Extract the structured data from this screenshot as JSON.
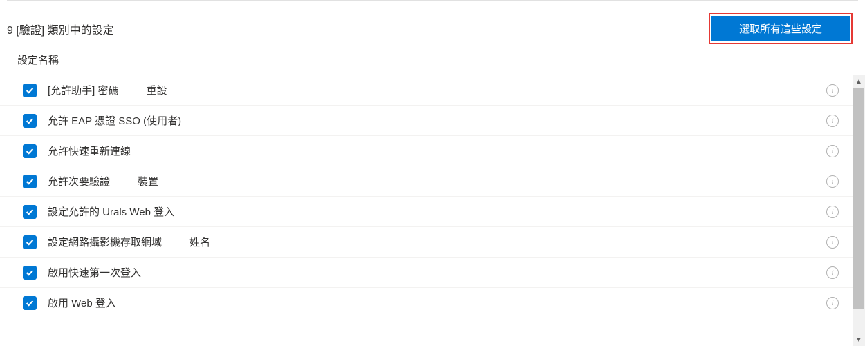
{
  "header": {
    "title": "9 [驗證] 類別中的設定",
    "select_all_label": "選取所有這些設定"
  },
  "column_header": "設定名稱",
  "settings": [
    {
      "label": "[允許助手]  密碼",
      "extra": "重設",
      "checked": true
    },
    {
      "label": "允許 EAP 憑證 SSO (使用者)",
      "extra": "",
      "checked": true
    },
    {
      "label": "允許快速重新連線",
      "extra": "",
      "checked": true
    },
    {
      "label": "允許次要驗證",
      "extra": "裝置",
      "checked": true
    },
    {
      "label": "設定允許的 Urals Web 登入",
      "extra": "",
      "checked": true
    },
    {
      "label": "設定網路攝影機存取網域",
      "extra": "姓名",
      "checked": true
    },
    {
      "label": "啟用快速第一次登入",
      "extra": "",
      "checked": true
    },
    {
      "label": "啟用 Web 登入",
      "extra": "",
      "checked": true
    }
  ]
}
